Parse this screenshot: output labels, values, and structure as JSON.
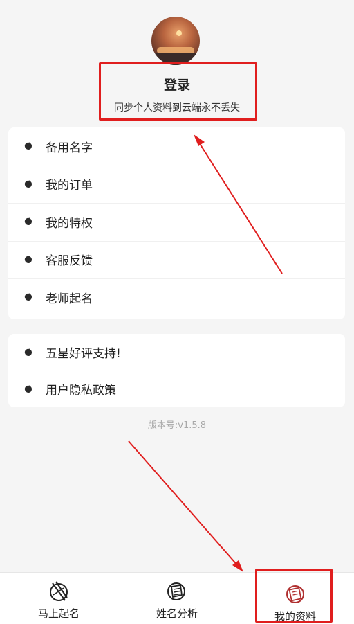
{
  "header": {
    "login_title": "登录",
    "login_subtitle": "同步个人资料到云端永不丢失"
  },
  "menu_group_1": [
    {
      "label": "备用名字",
      "icon": "ink-dot-icon"
    },
    {
      "label": "我的订单",
      "icon": "ink-dot-icon"
    },
    {
      "label": "我的特权",
      "icon": "ink-dot-icon"
    },
    {
      "label": "客服反馈",
      "icon": "ink-dot-icon"
    },
    {
      "label": "老师起名",
      "icon": "ink-dot-icon"
    }
  ],
  "menu_group_2": [
    {
      "label": "五星好评支持!",
      "icon": "ink-dot-icon"
    },
    {
      "label": "用户隐私政策",
      "icon": "ink-dot-icon"
    }
  ],
  "version": "版本号:v1.5.8",
  "tabbar": [
    {
      "label": "马上起名",
      "icon": "naming-brush-icon",
      "active": false
    },
    {
      "label": "姓名分析",
      "icon": "scroll-analysis-icon",
      "active": false
    },
    {
      "label": "我的资料",
      "icon": "profile-card-icon",
      "active": true
    }
  ],
  "colors": {
    "background": "#f5f5f5",
    "card": "#ffffff",
    "annotation_red": "#e01e1e",
    "version_text": "#a8a8a8",
    "active_tab_icon": "#b03030"
  }
}
